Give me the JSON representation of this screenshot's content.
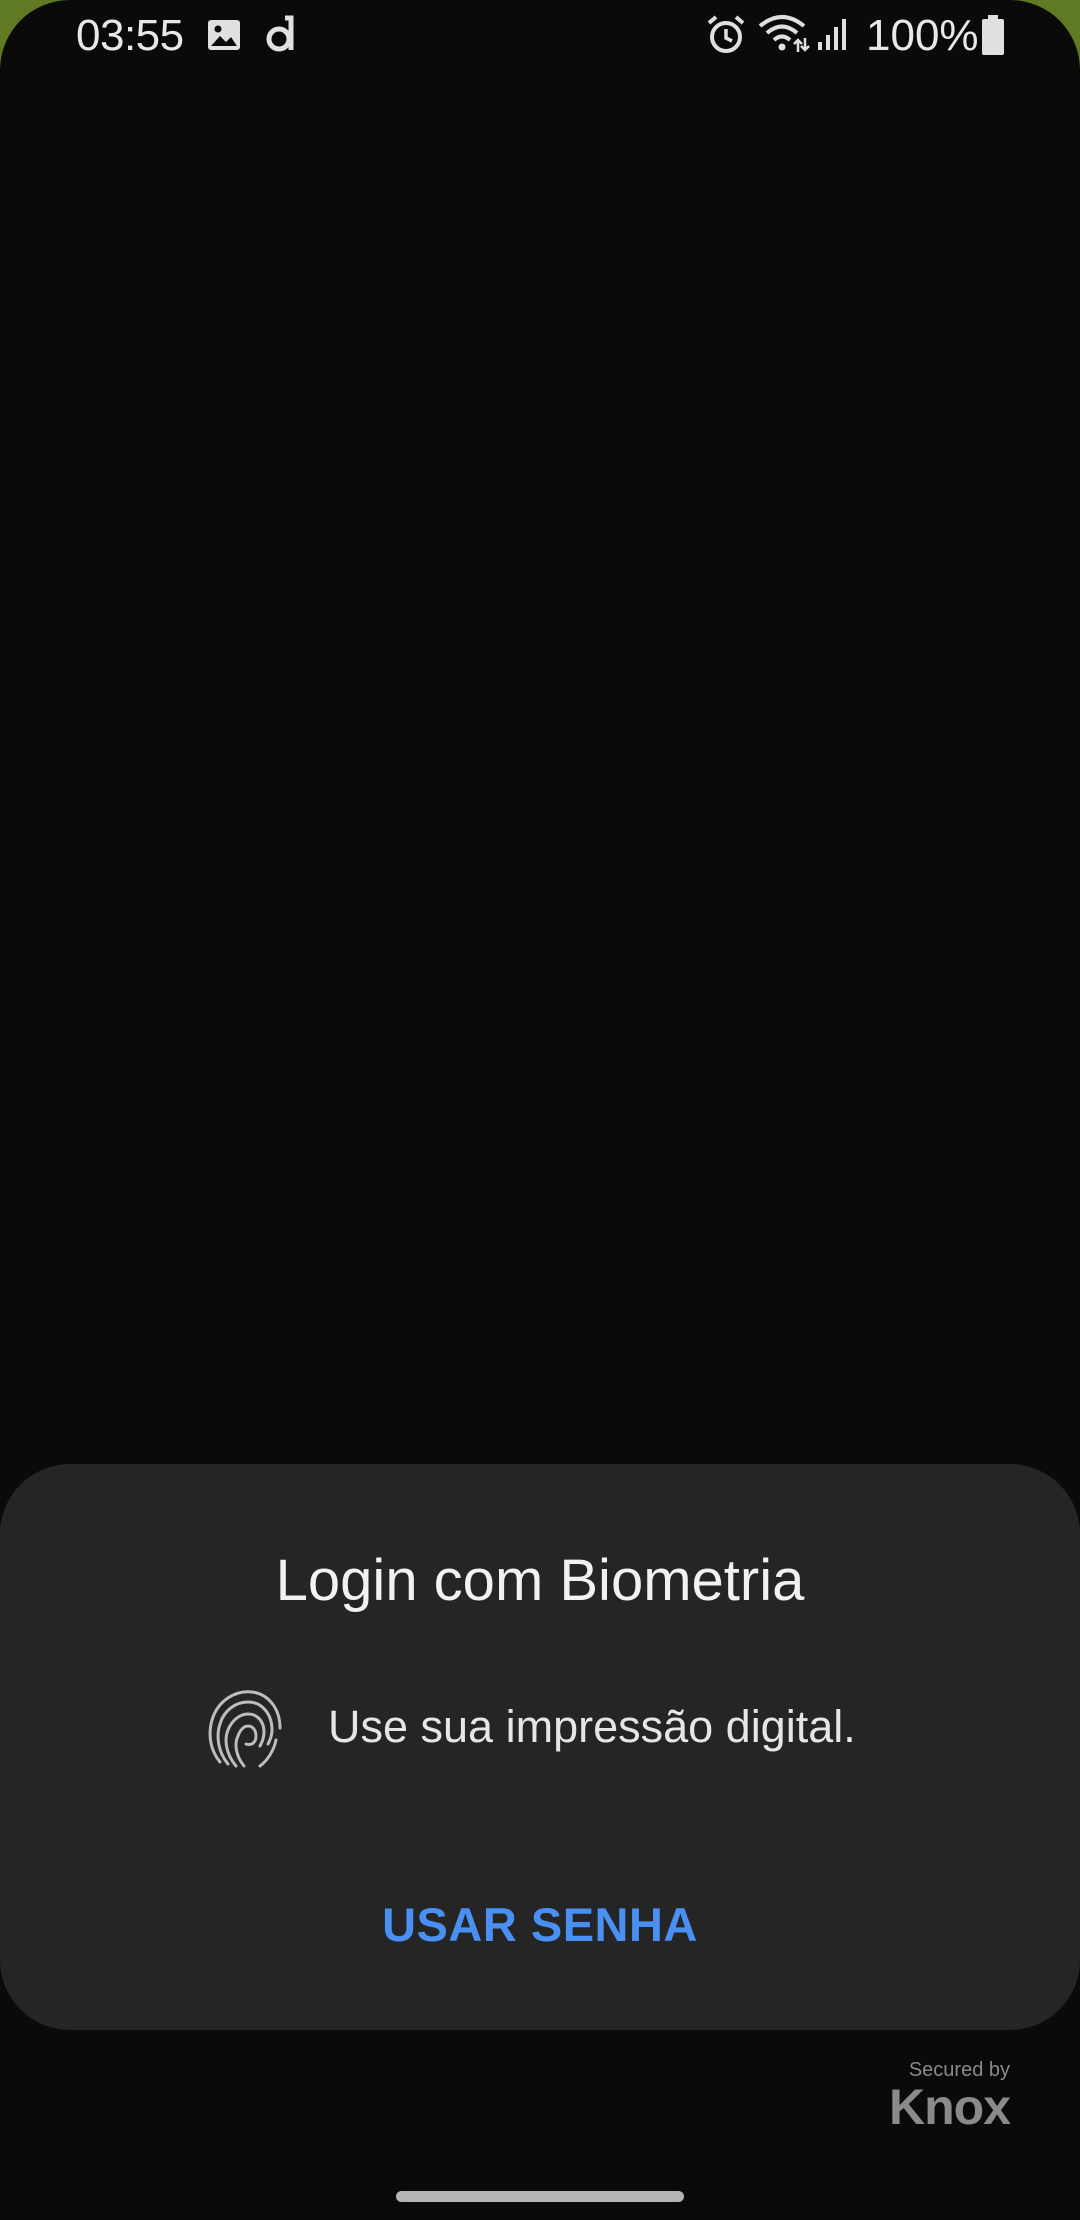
{
  "status_bar": {
    "time": "03:55",
    "battery_percent": "100%",
    "icons": [
      "gallery-icon",
      "d-app-icon",
      "alarm-icon",
      "wifi-icon",
      "signal-icon",
      "battery-icon"
    ]
  },
  "dialog": {
    "title": "Login com Biometria",
    "subtitle": "Use sua impressão digital.",
    "icon": "fingerprint-icon",
    "action_label": "USAR SENHA"
  },
  "knox": {
    "secured_by": "Secured by",
    "brand": "Knox"
  },
  "colors": {
    "background": "#0a0a0a",
    "sheet": "#252525",
    "accent": "#4a8ff2",
    "wallpaper_edge": "#5f7a22"
  }
}
